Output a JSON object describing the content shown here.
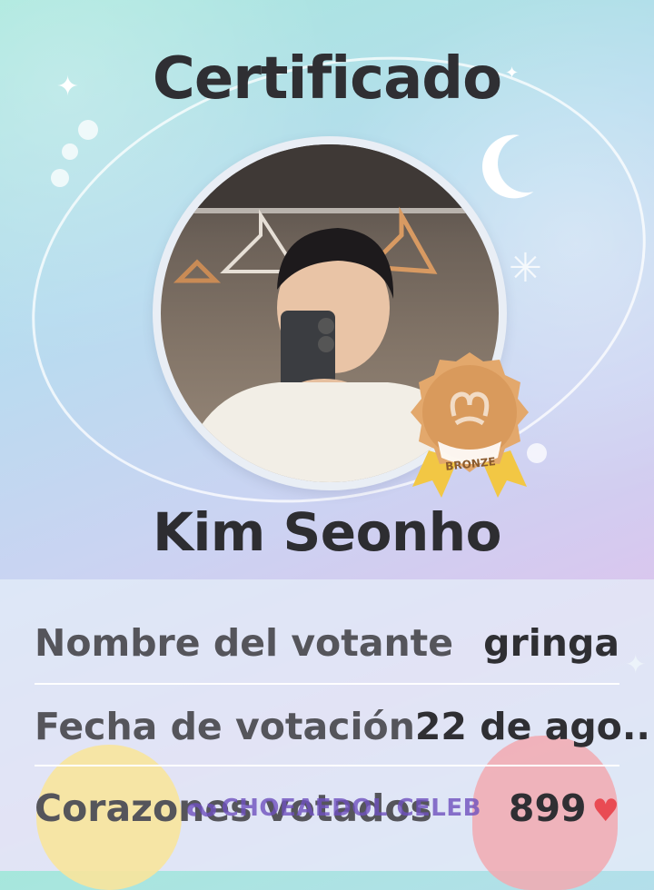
{
  "certificate": {
    "title": "Certificado",
    "celebrity_name": "Kim Seonho",
    "badge_label": "BRONZE"
  },
  "details": [
    {
      "label": "Nombre del votante",
      "value": "gringa"
    },
    {
      "label": "Fecha de votación",
      "value": "22 de ago..."
    },
    {
      "label": "Corazones votados",
      "value": "899"
    }
  ],
  "watermark": {
    "text": "CHOEAEDOL CELEB"
  },
  "icons": {
    "heart": "heart-icon",
    "badge": "bronze-medal-icon",
    "moon": "crescent-moon-icon",
    "sparkle": "sparkle-icon"
  },
  "colors": {
    "heart": "#e94b53",
    "bronze": "#d99a5c",
    "ribbon": "#f2c744"
  }
}
